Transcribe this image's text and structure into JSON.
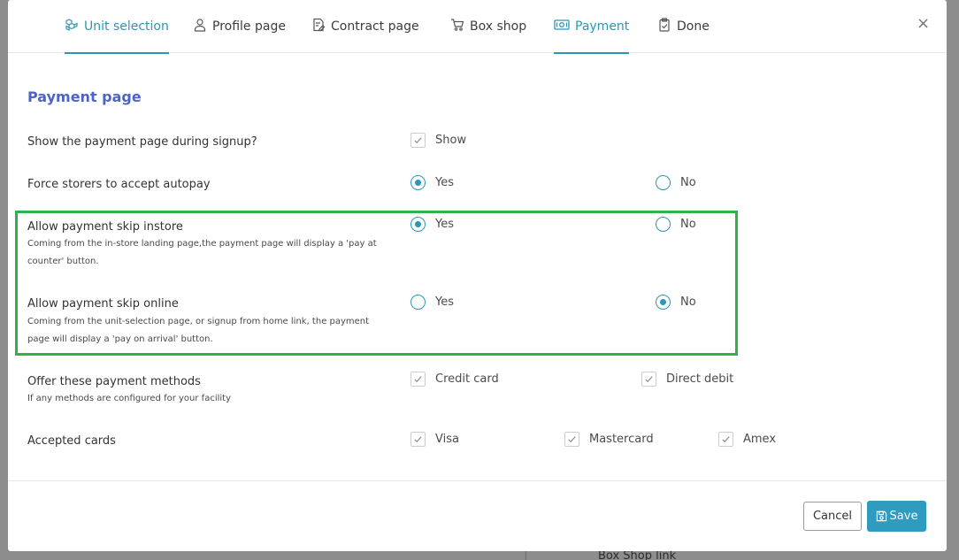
{
  "background": {
    "footer_link": "Box Shop link"
  },
  "tabs": [
    {
      "label": "Unit selection",
      "icon": "cubes-icon",
      "active": true
    },
    {
      "label": "Profile page",
      "icon": "user-icon",
      "active": false
    },
    {
      "label": "Contract page",
      "icon": "contract-icon",
      "active": false
    },
    {
      "label": "Box shop",
      "icon": "cart-icon",
      "active": false
    },
    {
      "label": "Payment",
      "icon": "money-icon",
      "active": true
    },
    {
      "label": "Done",
      "icon": "clipboard-check-icon",
      "active": false
    }
  ],
  "close_symbol": "×",
  "section_title": "Payment page",
  "rows": {
    "show_payment": {
      "label": "Show the payment page during signup?",
      "option": "Show",
      "checked": true
    },
    "force_autopay": {
      "label": "Force storers to accept autopay",
      "yes": "Yes",
      "no": "No",
      "selected": "Yes"
    },
    "skip_instore": {
      "label": "Allow payment skip instore",
      "sub": "Coming from the in-store landing page,the payment page will display a 'pay at counter' button.",
      "yes": "Yes",
      "no": "No",
      "selected": "Yes"
    },
    "skip_online": {
      "label": "Allow payment skip online",
      "sub": "Coming from the unit-selection page, or signup from home link, the payment page will display a 'pay on arrival' button.",
      "yes": "Yes",
      "no": "No",
      "selected": "No"
    },
    "methods": {
      "label": "Offer these payment methods",
      "sub": "If any methods are configured for your facility",
      "options": [
        "Credit card",
        "Direct debit"
      ]
    },
    "cards": {
      "label": "Accepted cards",
      "options": [
        "Visa",
        "Mastercard",
        "Amex"
      ]
    }
  },
  "buttons": {
    "cancel": "Cancel",
    "save": "Save"
  },
  "colors": {
    "accent": "#2d96b5",
    "title": "#4d64c6",
    "highlight": "#2cb34a",
    "save_bg": "#2e9bbf"
  }
}
